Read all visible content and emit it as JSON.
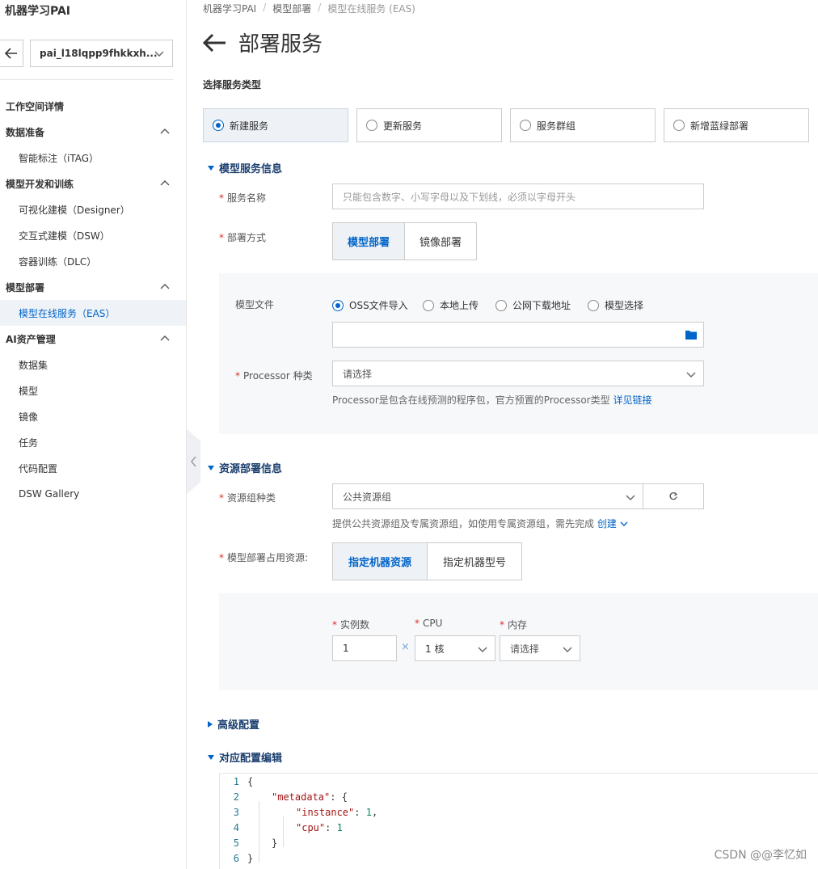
{
  "sidebar": {
    "brand": "机器学习PAI",
    "workspace": "pai_l18lqpp9fhkkxh...",
    "workspace_detail": "工作空间详情",
    "groups": [
      {
        "label": "数据准备",
        "items": [
          "智能标注（iTAG）"
        ]
      },
      {
        "label": "模型开发和训练",
        "items": [
          "可视化建模（Designer）",
          "交互式建模（DSW）",
          "容器训练（DLC）"
        ]
      },
      {
        "label": "模型部署",
        "items": [
          "模型在线服务（EAS）"
        ]
      },
      {
        "label": "AI资产管理",
        "items": [
          "数据集",
          "模型",
          "镜像",
          "任务",
          "代码配置",
          "DSW Gallery"
        ]
      }
    ],
    "active_item": "模型在线服务（EAS）"
  },
  "breadcrumb": [
    "机器学习PAI",
    "模型部署",
    "模型在线服务 (EAS)"
  ],
  "page": {
    "title": "部署服务",
    "service_type_label": "选择服务类型",
    "service_types": [
      "新建服务",
      "更新服务",
      "服务群组",
      "新增蓝绿部署"
    ],
    "selected_service_type": "新建服务"
  },
  "model_info": {
    "section_title": "模型服务信息",
    "service_name_label": "服务名称",
    "service_name_placeholder": "只能包含数字、小写字母以及下划线，必须以字母开头",
    "deploy_mode_label": "部署方式",
    "deploy_modes": [
      "模型部署",
      "镜像部署"
    ],
    "model_file_label": "模型文件",
    "model_file_options": [
      "OSS文件导入",
      "本地上传",
      "公网下载地址",
      "模型选择"
    ],
    "oss_path": "",
    "processor_label": "Processor 种类",
    "processor_placeholder": "请选择",
    "processor_help": "Processor是包含在线预测的程序包，官方预置的Processor类型",
    "processor_help_link": "详见链接"
  },
  "resource_info": {
    "section_title": "资源部署信息",
    "group_type_label": "资源组种类",
    "group_type_value": "公共资源组",
    "group_help": "提供公共资源组及专属资源组，如使用专属资源组，需先完成",
    "group_help_link": "创建",
    "occupy_label": "模型部署占用资源:",
    "occupy_modes": [
      "指定机器资源",
      "指定机器型号"
    ],
    "instances_label": "实例数",
    "instances_value": "1",
    "cpu_label": "CPU",
    "cpu_value": "1 核",
    "memory_label": "内存",
    "memory_value": "请选择"
  },
  "advanced": {
    "section_title": "高级配置"
  },
  "config_editor": {
    "section_title": "对应配置编辑",
    "lines": [
      "1",
      "2",
      "3",
      "4",
      "5",
      "6"
    ],
    "metadata_key": "\"metadata\"",
    "instance_key": "\"instance\"",
    "instance_value": "1",
    "cpu_key": "\"cpu\"",
    "cpu_value": "1"
  },
  "watermark": "CSDN @@李忆如"
}
